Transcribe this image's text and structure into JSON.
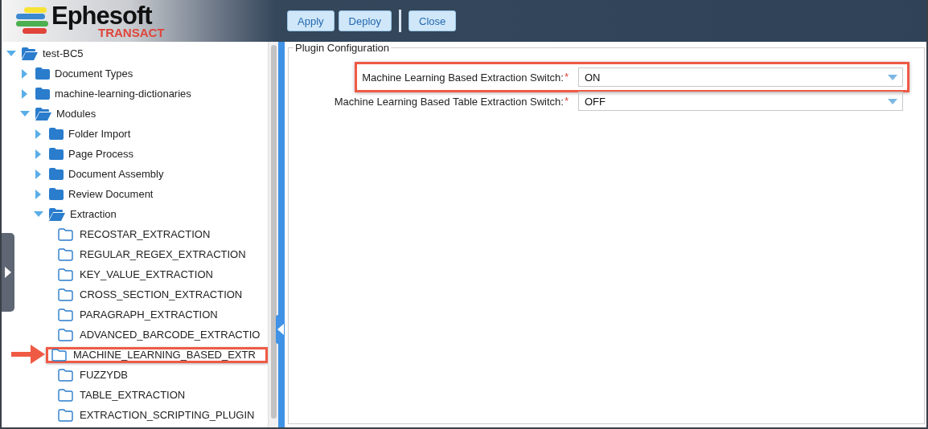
{
  "header": {
    "logo": {
      "name": "Ephesoft",
      "product": "TRANSACT"
    },
    "buttons": [
      "Apply",
      "Deploy"
    ],
    "close_button": "Close"
  },
  "tree": [
    {
      "label": "test-BC5",
      "kind": "branch",
      "expanded": true,
      "children": [
        {
          "label": "Document Types",
          "kind": "branch",
          "expanded": false
        },
        {
          "label": "machine-learning-dictionaries",
          "kind": "branch",
          "expanded": false
        },
        {
          "label": "Modules",
          "kind": "branch",
          "expanded": true,
          "children": [
            {
              "label": "Folder Import",
              "kind": "branch",
              "expanded": false
            },
            {
              "label": "Page Process",
              "kind": "branch",
              "expanded": false
            },
            {
              "label": "Document Assembly",
              "kind": "branch",
              "expanded": false
            },
            {
              "label": "Review Document",
              "kind": "branch",
              "expanded": false
            },
            {
              "label": "Extraction",
              "kind": "branch",
              "expanded": true,
              "children": [
                {
                  "label": "RECOSTAR_EXTRACTION",
                  "kind": "leaf",
                  "highlighted": false
                },
                {
                  "label": "REGULAR_REGEX_EXTRACTION",
                  "kind": "leaf",
                  "highlighted": false
                },
                {
                  "label": "KEY_VALUE_EXTRACTION",
                  "kind": "leaf",
                  "highlighted": false
                },
                {
                  "label": "CROSS_SECTION_EXTRACTION",
                  "kind": "leaf",
                  "highlighted": false
                },
                {
                  "label": "PARAGRAPH_EXTRACTION",
                  "kind": "leaf",
                  "highlighted": false
                },
                {
                  "label": "ADVANCED_BARCODE_EXTRACTIO",
                  "kind": "leaf",
                  "highlighted": false
                },
                {
                  "label": "MACHINE_LEARNING_BASED_EXTR",
                  "kind": "leaf",
                  "highlighted": true
                },
                {
                  "label": "FUZZYDB",
                  "kind": "leaf",
                  "highlighted": false
                },
                {
                  "label": "TABLE_EXTRACTION",
                  "kind": "leaf",
                  "highlighted": false
                },
                {
                  "label": "EXTRACTION_SCRIPTING_PLUGIN",
                  "kind": "leaf",
                  "highlighted": false
                }
              ]
            }
          ]
        }
      ]
    }
  ],
  "panel": {
    "title": "Plugin Configuration",
    "fields": [
      {
        "label": "Machine Learning Based Extraction Switch:",
        "required_mark": "*",
        "value": "ON",
        "highlighted": true
      },
      {
        "label": "Machine Learning Based Table Extraction Switch:",
        "required_mark": "*",
        "value": "OFF",
        "highlighted": false
      }
    ]
  }
}
